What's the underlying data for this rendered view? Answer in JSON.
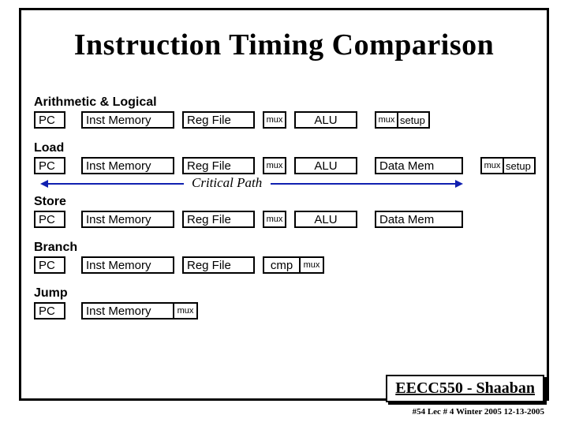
{
  "title": "Instruction Timing Comparison",
  "stages": {
    "pc": "PC",
    "im": "Inst Memory",
    "rf": "Reg File",
    "mux": "mux",
    "alu": "ALU",
    "dm": "Data Mem",
    "setup": "setup",
    "cmp": "cmp"
  },
  "groups": {
    "arith": "Arithmetic & Logical",
    "load": "Load",
    "store": "Store",
    "branch": "Branch",
    "jump": "Jump"
  },
  "critical_path": "Critical Path",
  "footer": {
    "course": "EECC550 - Shaaban",
    "line": "#54   Lec # 4   Winter 2005   12-13-2005"
  }
}
